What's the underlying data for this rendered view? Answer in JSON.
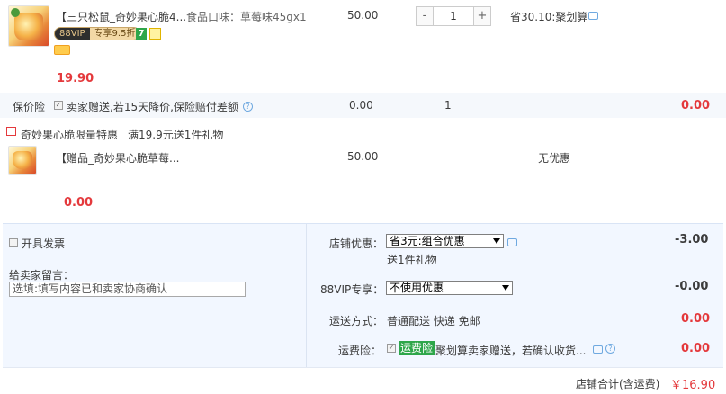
{
  "item": {
    "title": "【三只松鼠_奇妙果心脆4...",
    "sku_label": "食品口味：草莓味45gx1",
    "unit_price": "50.00",
    "quantity": "1",
    "qty_minus": "-",
    "qty_plus": "+",
    "discount_text": "省30.10:聚划算",
    "vip_badge_left": "88VIP",
    "vip_badge_right": "专享9.5折",
    "badge_7": "7",
    "final_price": "19.90"
  },
  "protection": {
    "label": "保价险",
    "desc": "卖家赠送,若15天降价,保险赔付差额",
    "price": "0.00",
    "qty": "1",
    "total": "0.00"
  },
  "promo": {
    "title": "奇妙果心脆限量特惠",
    "desc": "满19.9元送1件礼物"
  },
  "gift": {
    "title": "【赠品_奇妙果心脆草莓...",
    "price": "50.00",
    "discount_text": "无优惠",
    "final_price": "0.00"
  },
  "footer": {
    "invoice_label": "开具发票",
    "message_label": "给卖家留言：",
    "message_placeholder": "选填:填写内容已和卖家协商确认",
    "shop_discount_label": "店铺优惠：",
    "shop_discount_value": "省3元:组合优惠",
    "shop_discount_sub": "送1件礼物",
    "shop_discount_amount": "-3.00",
    "vip_label": "88VIP专享：",
    "vip_value": "不使用优惠",
    "vip_amount": "-0.00",
    "shipping_label": "运送方式：",
    "shipping_value": "普通配送 快递 免邮",
    "shipping_amount": "0.00",
    "freight_ins_label": "运费险：",
    "freight_ins_tag": "运费险",
    "freight_ins_desc": "聚划算卖家赠送，若确认收货...",
    "freight_ins_amount": "0.00",
    "total_label": "店铺合计(含运费)",
    "total_amount": "￥16.90"
  },
  "colors": {
    "accent_red": "#e4393c",
    "panel_bg": "#f2f7ff",
    "freight_tag_bg": "#2ea64a"
  }
}
